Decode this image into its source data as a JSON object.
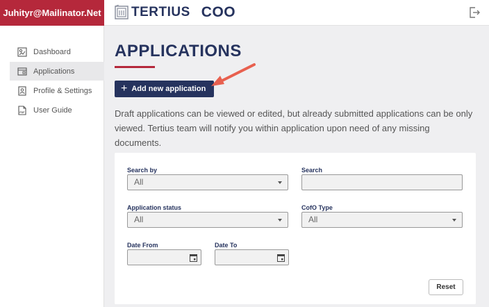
{
  "header": {
    "user_email": "Juhityr@Mailinator.Net",
    "logo_text": "TERTIUS",
    "logo_sub": "COO",
    "brand_color": "#26335e",
    "accent_color": "#b5283b"
  },
  "sidebar": {
    "items": [
      {
        "label": "Dashboard",
        "icon": "dashboard-icon",
        "active": false
      },
      {
        "label": "Applications",
        "icon": "applications-icon",
        "active": true
      },
      {
        "label": "Profile & Settings",
        "icon": "profile-icon",
        "active": false
      },
      {
        "label": "User Guide",
        "icon": "pdf-icon",
        "active": false
      }
    ]
  },
  "main": {
    "title": "APPLICATIONS",
    "add_button_label": "Add new application",
    "intro_text": "Draft applications can be viewed or edited, but already submitted applications can be only viewed. Tertius team will notify you within application upon need of any missing documents."
  },
  "filters": {
    "search_by_label": "Search by",
    "search_by_value": "All",
    "search_label": "Search",
    "search_value": "",
    "status_label": "Application status",
    "status_value": "All",
    "cofo_label": "CofO Type",
    "cofo_value": "All",
    "date_from_label": "Date From",
    "date_from_value": "",
    "date_to_label": "Date To",
    "date_to_value": "",
    "reset_label": "Reset"
  }
}
